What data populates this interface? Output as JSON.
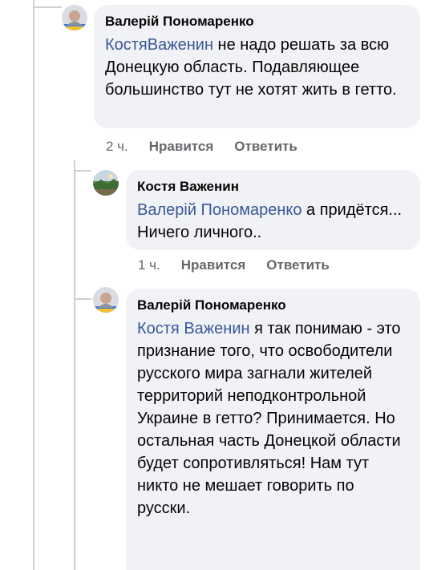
{
  "comments": [
    {
      "author": "Валерій Пономаренко",
      "mention": "КостяВаженин",
      "text": " не надо решать за всю Донецкую область. Подавляющее большинство тут не хотят жить в гетто.",
      "time": "2 ч.",
      "like_label": "Нравится",
      "reply_label": "Ответить"
    },
    {
      "author": "Костя Важенин",
      "mention": "Валерій Пономаренко",
      "text": " а придётся... Ничего личного..",
      "time": "1 ч.",
      "like_label": "Нравится",
      "reply_label": "Ответить"
    },
    {
      "author": "Валерій Пономаренко",
      "mention": "Костя Важенин",
      "text": " я так понимаю - это признание того, что освободители русского мира загнали жителей территорий неподконтрольной Украине в гетто? Принимается. Но остальная часть Донецкой области будет сопротивляться! Нам тут никто не мешает говорить по русски."
    }
  ],
  "colors": {
    "mention": "#385898",
    "bubble": "#f0f2f5",
    "meta": "#65676b"
  }
}
